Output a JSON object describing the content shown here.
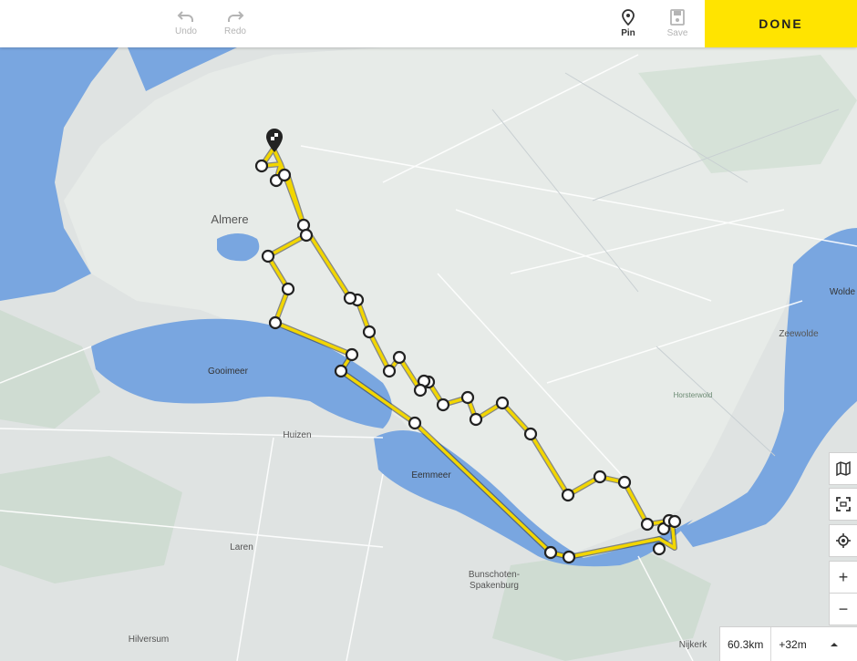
{
  "toolbar": {
    "undo_label": "Undo",
    "redo_label": "Redo",
    "pin_label": "Pin",
    "save_label": "Save",
    "done_label": "DONE"
  },
  "map_labels": {
    "almere": "Almere",
    "gooimeer": "Gooimeer",
    "huizen": "Huizen",
    "eemmeer": "Eemmeer",
    "laren": "Laren",
    "bunschoten_1": "Bunschoten-",
    "bunschoten_2": "Spakenburg",
    "hilversum": "Hilversum",
    "nijkerk": "Nijkerk",
    "zeewolde": "Zeewolde",
    "horsterwold": "Horsterwold",
    "wolde": "Wolde"
  },
  "route_stats": {
    "distance": "60.3km",
    "elevation": "+32m"
  },
  "colors": {
    "accent": "#ffe400",
    "route": "#f2d600",
    "water": "#79a6e0",
    "land": "#dfe3e2"
  },
  "icons": [
    "undo-icon",
    "redo-icon",
    "pin-icon",
    "save-icon",
    "map-layers-icon",
    "fullscreen-icon",
    "locate-icon",
    "zoom-in-icon",
    "zoom-out-icon",
    "caret-up-icon",
    "start-marker-icon"
  ]
}
